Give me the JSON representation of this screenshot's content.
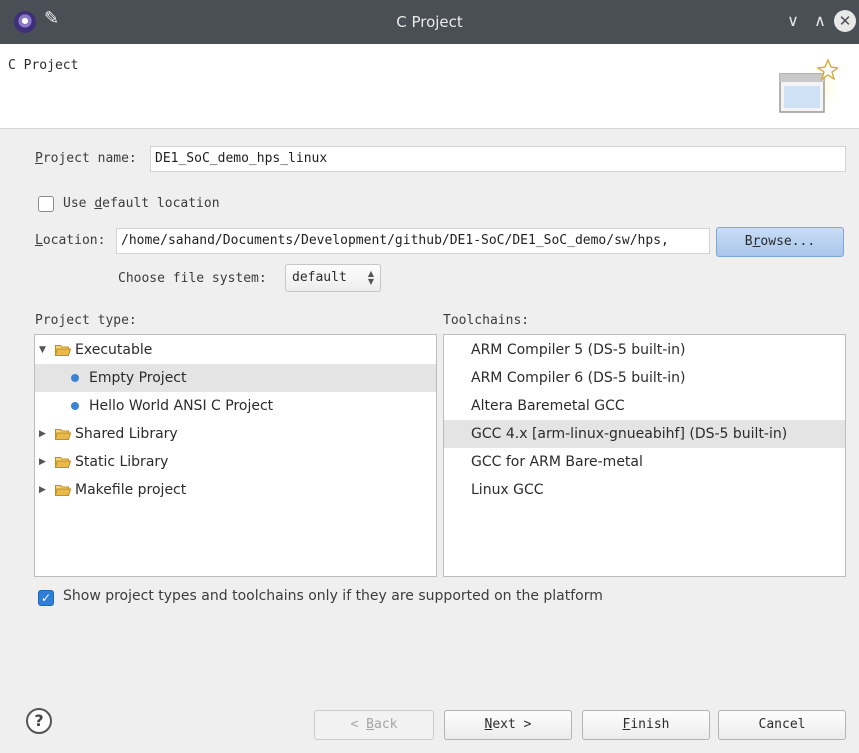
{
  "window": {
    "title": "C Project",
    "app_icon": "eclipse-icon",
    "pin_icon": "pin-icon",
    "minimize_glyph": "∨",
    "maximize_glyph": "∧",
    "close_glyph": "✕"
  },
  "banner": {
    "heading": "C Project",
    "icon": "new-project-wizard-icon"
  },
  "form": {
    "project_name_label_mnemonic": "P",
    "project_name_label_rest": "roject name:",
    "project_name_value": "DE1_SoC_demo_hps_linux",
    "use_default_location_prefix": "Use ",
    "use_default_location_mnemonic": "d",
    "use_default_location_rest": "efault location",
    "use_default_location_checked": false,
    "location_label_mnemonic": "L",
    "location_label_rest": "ocation:",
    "location_value": "/home/sahand/Documents/Development/github/DE1-SoC/DE1_SoC_demo/sw/hps,",
    "browse_prefix": "B",
    "browse_mnemonic": "r",
    "browse_rest": "owse...",
    "file_system_label": "Choose file system:",
    "file_system_value": "default"
  },
  "project_type": {
    "label": "Project type:",
    "items": [
      {
        "label": "Executable",
        "kind": "folder",
        "expanded": true,
        "level": 0
      },
      {
        "label": "Empty Project",
        "kind": "leaf",
        "level": 1,
        "selected": true
      },
      {
        "label": "Hello World ANSI C Project",
        "kind": "leaf",
        "level": 1
      },
      {
        "label": "Shared Library",
        "kind": "folder",
        "expanded": false,
        "level": 0
      },
      {
        "label": "Static Library",
        "kind": "folder",
        "expanded": false,
        "level": 0
      },
      {
        "label": "Makefile project",
        "kind": "folder",
        "expanded": false,
        "level": 0
      }
    ]
  },
  "toolchains": {
    "label": "Toolchains:",
    "items": [
      {
        "label": "ARM Compiler 5 (DS-5 built-in)"
      },
      {
        "label": "ARM Compiler 6 (DS-5 built-in)"
      },
      {
        "label": "Altera Baremetal GCC"
      },
      {
        "label": "GCC 4.x [arm-linux-gnueabihf] (DS-5 built-in)",
        "selected": true
      },
      {
        "label": "GCC for ARM Bare-metal"
      },
      {
        "label": "Linux GCC"
      }
    ]
  },
  "filter": {
    "label": "Show project types and toolchains only if they are supported on the platform",
    "checked": true
  },
  "footer": {
    "help_glyph": "?",
    "back_prefix": "< ",
    "back_mnemonic": "B",
    "back_rest": "ack",
    "next_mnemonic": "N",
    "next_rest": "ext >",
    "finish_mnemonic": "F",
    "finish_rest": "inish",
    "cancel_label": "Cancel"
  },
  "colors": {
    "titlebar": "#4a4f56",
    "selection": "#e4e4e4",
    "accent": "#2f7fd8",
    "folder": "#e9b94a"
  }
}
